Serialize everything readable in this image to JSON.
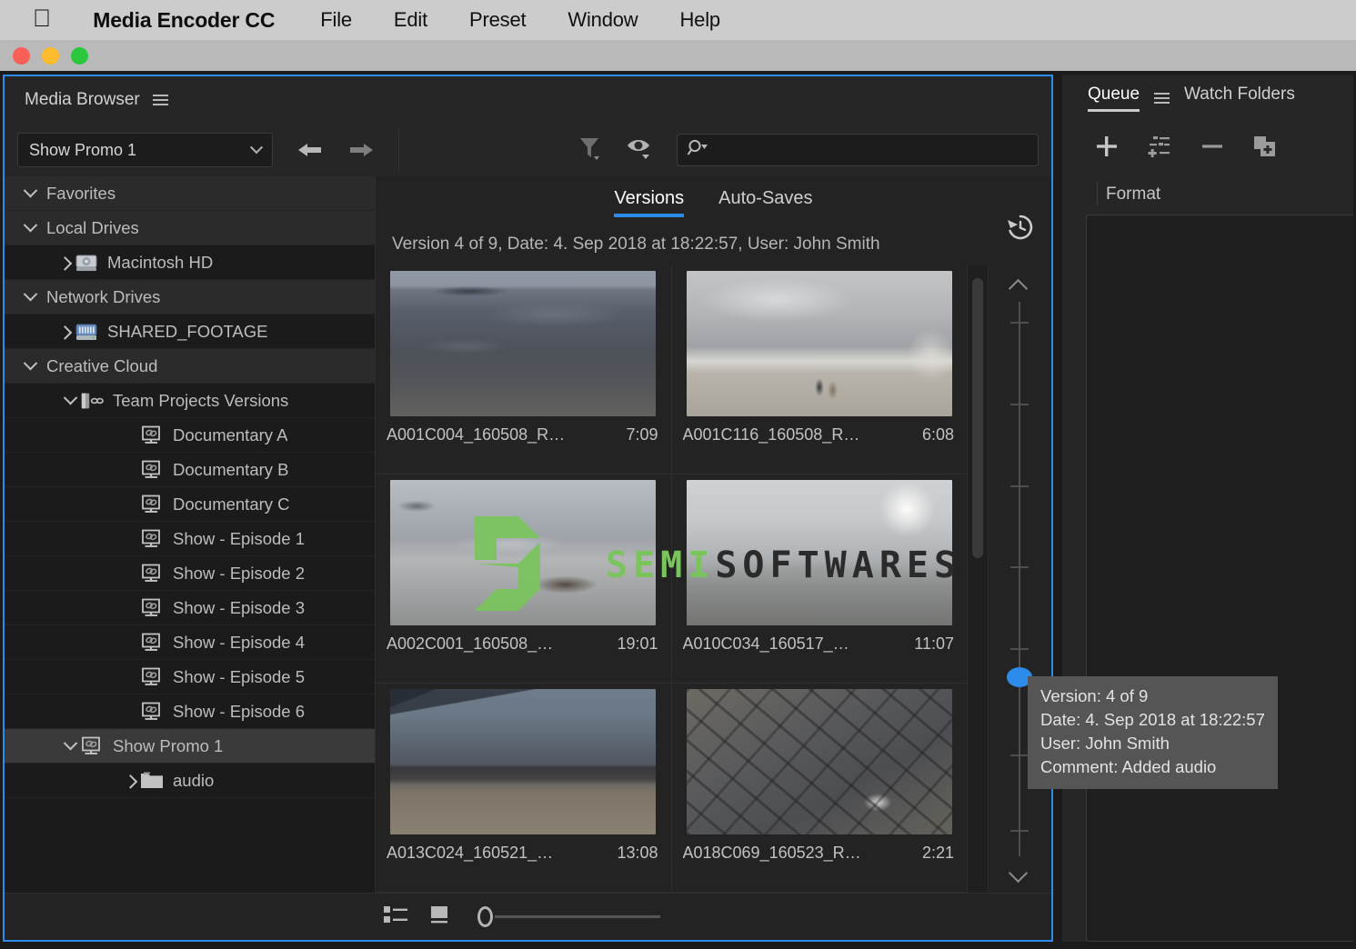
{
  "menubar": {
    "apple_glyph": "&#63743;",
    "app_name": "Media Encoder CC",
    "items": [
      "File",
      "Edit",
      "Preset",
      "Window",
      "Help"
    ]
  },
  "window_controls": {
    "close": "close-button",
    "minimize": "minimize-button",
    "zoom": "zoom-button"
  },
  "media_browser": {
    "title": "Media Browser",
    "panel_menu_icon": "hamburger-menu-icon",
    "path_select": {
      "value": "Show Promo 1",
      "chevron": "chevron-down-icon"
    },
    "nav": {
      "back": "back-arrow-icon",
      "forward": "forward-arrow-icon"
    },
    "filter_icon": "funnel-filter-icon",
    "visibility_icon": "eye-visibility-icon",
    "search": {
      "value": "",
      "placeholder": "",
      "icon": "search-magnifier-icon"
    },
    "tree": [
      {
        "label": "Favorites",
        "level": 0,
        "twisty": "down",
        "icon": "none",
        "kind": "group",
        "state": "normal"
      },
      {
        "label": "Local Drives",
        "level": 0,
        "twisty": "down",
        "icon": "none",
        "kind": "group",
        "state": "normal"
      },
      {
        "label": "Macintosh HD",
        "level": 1,
        "twisty": "right",
        "icon": "hard-drive-icon",
        "kind": "drive",
        "state": "normal"
      },
      {
        "label": "Network Drives",
        "level": 0,
        "twisty": "down",
        "icon": "none",
        "kind": "group",
        "state": "normal"
      },
      {
        "label": "SHARED_FOOTAGE",
        "level": 1,
        "twisty": "right",
        "icon": "network-drive-icon",
        "kind": "drive",
        "state": "normal"
      },
      {
        "label": "Creative Cloud",
        "level": 0,
        "twisty": "down",
        "icon": "none",
        "kind": "group",
        "state": "normal"
      },
      {
        "label": "Team Projects Versions",
        "level": 2,
        "twisty": "down",
        "icon": "team-projects-icon",
        "kind": "node",
        "state": "normal"
      },
      {
        "label": "Documentary A",
        "level": 3,
        "twisty": "none",
        "icon": "project-icon",
        "kind": "project",
        "state": "normal"
      },
      {
        "label": "Documentary B",
        "level": 3,
        "twisty": "none",
        "icon": "project-icon",
        "kind": "project",
        "state": "normal"
      },
      {
        "label": "Documentary C",
        "level": 3,
        "twisty": "none",
        "icon": "project-icon",
        "kind": "project",
        "state": "normal"
      },
      {
        "label": "Show - Episode 1",
        "level": 3,
        "twisty": "none",
        "icon": "project-icon",
        "kind": "project",
        "state": "normal"
      },
      {
        "label": "Show - Episode 2",
        "level": 3,
        "twisty": "none",
        "icon": "project-icon",
        "kind": "project",
        "state": "normal"
      },
      {
        "label": "Show - Episode 3",
        "level": 3,
        "twisty": "none",
        "icon": "project-icon",
        "kind": "project",
        "state": "normal"
      },
      {
        "label": "Show - Episode 4",
        "level": 3,
        "twisty": "none",
        "icon": "project-icon",
        "kind": "project",
        "state": "normal"
      },
      {
        "label": "Show - Episode 5",
        "level": 3,
        "twisty": "none",
        "icon": "project-icon",
        "kind": "project",
        "state": "normal"
      },
      {
        "label": "Show - Episode 6",
        "level": 3,
        "twisty": "none",
        "icon": "project-icon",
        "kind": "project",
        "state": "normal"
      },
      {
        "label": "Show Promo 1",
        "level": 2,
        "twisty": "down",
        "icon": "project-icon",
        "kind": "project",
        "state": "selected"
      },
      {
        "label": "audio",
        "level": 3,
        "twisty": "right",
        "icon": "folder-icon",
        "kind": "folder",
        "state": "normal"
      }
    ],
    "versions": {
      "tabs": [
        {
          "label": "Versions",
          "active": true
        },
        {
          "label": "Auto-Saves",
          "active": false
        }
      ],
      "summary": "Version 4 of 9, Date: 4. Sep 2018 at 18:22:57, User: John Smith",
      "history_icon": "history-clock-icon",
      "items": [
        {
          "name": "A001C004_160508_R…",
          "duration": "7:09",
          "scene": "lake-shore-dusk"
        },
        {
          "name": "A001C116_160508_R…",
          "duration": "6:08",
          "scene": "overcast-field-walkers"
        },
        {
          "name": "A002C001_160508_…",
          "duration": "19:01",
          "scene": "wet-flats-wreck"
        },
        {
          "name": "A010C034_160517_…",
          "duration": "11:07",
          "scene": "hazy-sun-village"
        },
        {
          "name": "A013C024_160521_…",
          "duration": "13:08",
          "scene": "bridge-city-skyline"
        },
        {
          "name": "A018C069_160523_R…",
          "duration": "2:21",
          "scene": "aerial-city-blocks"
        }
      ],
      "timeline": {
        "handle_label": "version-handle",
        "up": "scroll-up-chevron",
        "down": "scroll-down-chevron"
      }
    },
    "tooltip": {
      "version": "Version: 4 of 9",
      "date": "Date: 4. Sep 2018 at 18:22:57",
      "user": "User: John Smith",
      "comment": "Comment: Added audio"
    },
    "footer": {
      "list_view_icon": "list-view-icon",
      "thumbnail_view_icon": "thumbnail-view-icon",
      "zoom_slider": "thumbnail-zoom-slider"
    }
  },
  "queue": {
    "tabs": [
      {
        "label": "Queue",
        "active": true
      },
      {
        "label": "Watch Folders",
        "active": false
      }
    ],
    "panel_menu_icon": "hamburger-menu-icon",
    "toolbar": [
      {
        "name": "add-source-button",
        "icon": "plus-icon"
      },
      {
        "name": "add-preset-button",
        "icon": "preset-sliders-plus-icon"
      },
      {
        "name": "remove-button",
        "icon": "minus-icon"
      },
      {
        "name": "duplicate-button",
        "icon": "duplicate-plus-icon"
      }
    ],
    "columns": [
      "Format"
    ],
    "rows": []
  },
  "watermark": {
    "mark": "s-logo-mark",
    "text_a": "SEMI",
    "text_b": "SOFTWARES"
  },
  "colors": {
    "accent_blue": "#2d8ceb",
    "panel_bg": "#262626",
    "tree_bg": "#1b1b1b",
    "selected_row": "#3a3a3a",
    "tooltip_bg": "#555555",
    "menubar_bg": "#cccccc",
    "watermark_green": "#79c45c"
  }
}
